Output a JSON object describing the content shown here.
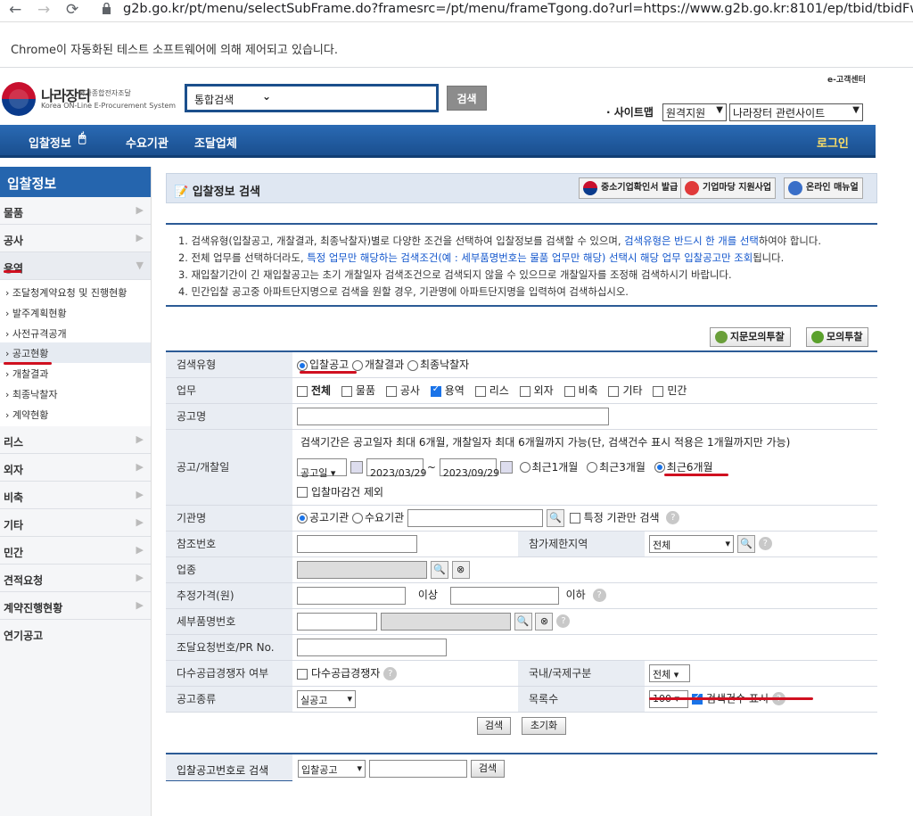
{
  "browser": {
    "url": "g2b.go.kr/pt/menu/selectSubFrame.do?framesrc=/pt/menu/frameTgong.do?url=https://www.g2b.go.kr:8101/ep/tbid/tbidFwd.do",
    "infobar": "Chrome이 자동화된 테스트 소프트웨어에 의해 제어되고 있습니다."
  },
  "header": {
    "logo_korean": "나라장터",
    "logo_sub": "국가종합전자조달",
    "logo_en": "Korea ON-Line E-Procurement System",
    "search_scope": "통합검색",
    "search_button": "검색",
    "customer_center": "e-고객센터",
    "sitemap": "· 사이트맵",
    "select_remote": "원격지원",
    "select_related": "나라장터 관련사이트"
  },
  "gnb": {
    "items": [
      "입찰정보",
      "수요기관",
      "조달업체"
    ],
    "login": "로그인"
  },
  "lnb": {
    "title": "입찰정보",
    "menu_top": [
      "물품",
      "공사",
      "용역"
    ],
    "sub": [
      "조달청계약요청 및 진행현황",
      "발주계획현황",
      "사전규격공개",
      "공고현황",
      "개찰결과",
      "최종낙찰자",
      "계약현황"
    ],
    "menu_bottom": [
      "리스",
      "외자",
      "비축",
      "기타",
      "민간",
      "견적요청",
      "계약진행현황",
      "연기공고"
    ]
  },
  "page": {
    "title": "입찰정보 검색",
    "btn1": "중소기업확인서 발급",
    "btn2": "기업마당 지원사업",
    "btn3": "온라인 매뉴얼"
  },
  "notice": {
    "l1a": "1. 검색유형(입찰공고, 개찰결과, 최종낙찰자)별로 다양한 조건을 선택하여 입찰정보를 검색할 수 있으며, ",
    "l1b": "검색유형은 반드시 한 개를 선택",
    "l1c": "하여야 합니다.",
    "l2a": "2. 전체 업무를 선택하더라도, ",
    "l2b": "특정 업무만 해당하는 검색조건(예 : 세부품명번호는 물품 업무만 해당) 선택시 해당 업무 입찰공고만 조회",
    "l2c": "됩니다.",
    "l3": "3. 재입찰기간이 긴 재입찰공고는 초기 개찰일자 검색조건으로 검색되지 않을 수 있으므로 개찰일자를 조정해 검색하시기 바랍니다.",
    "l4": "4. 민간입찰 공고중 아파트단지명으로 검색을 원할 경우, 기관명에 아파트단지명을 입력하여 검색하십시오."
  },
  "buttons": {
    "mock1": "지문모의투찰",
    "mock2": "모의투찰",
    "search": "검색",
    "reset": "초기화"
  },
  "form": {
    "l_type": "검색유형",
    "type_opts": [
      "입찰공고",
      "개찰결과",
      "최종낙찰자"
    ],
    "l_biz": "업무",
    "biz_opts": [
      "전체",
      "물품",
      "공사",
      "용역",
      "리스",
      "외자",
      "비축",
      "기타",
      "민간"
    ],
    "l_name": "공고명",
    "l_date": "공고/개찰일",
    "date_note": "검색기간은 공고일자 최대 6개월, 개찰일자 최대 6개월까지 가능(단, 검색건수 표시 적용은 1개월까지만 가능)",
    "date_type": "공고일",
    "date_from": "2023/03/29",
    "date_to": "2023/09/29",
    "tilde": "~",
    "date_opts": [
      "최근1개월",
      "최근3개월",
      "최근6개월"
    ],
    "exclude": "입찰마감건 제외",
    "l_org": "기관명",
    "org_opts": [
      "공고기관",
      "수요기관"
    ],
    "org_only": "특정 기관만 검색",
    "l_ref": "참조번호",
    "l_region": "참가제한지역",
    "region_val": "전체",
    "l_industry": "업종",
    "l_price": "추정가격(원)",
    "above": "이상",
    "below": "이하",
    "l_item": "세부품명번호",
    "l_req": "조달요청번호/PR No.",
    "l_multi": "다수공급경쟁자 여부",
    "multi_opt": "다수공급경쟁자",
    "l_intl": "국내/국제구분",
    "intl_val": "전체",
    "l_kind": "공고종류",
    "kind_val": "실공고",
    "l_rows": "목록수",
    "rows_val": "100",
    "show_count": "검색건수 표시"
  },
  "bottom": {
    "label": "입찰공고번호로 검색",
    "sel": "입찰공고",
    "btn": "검색"
  }
}
